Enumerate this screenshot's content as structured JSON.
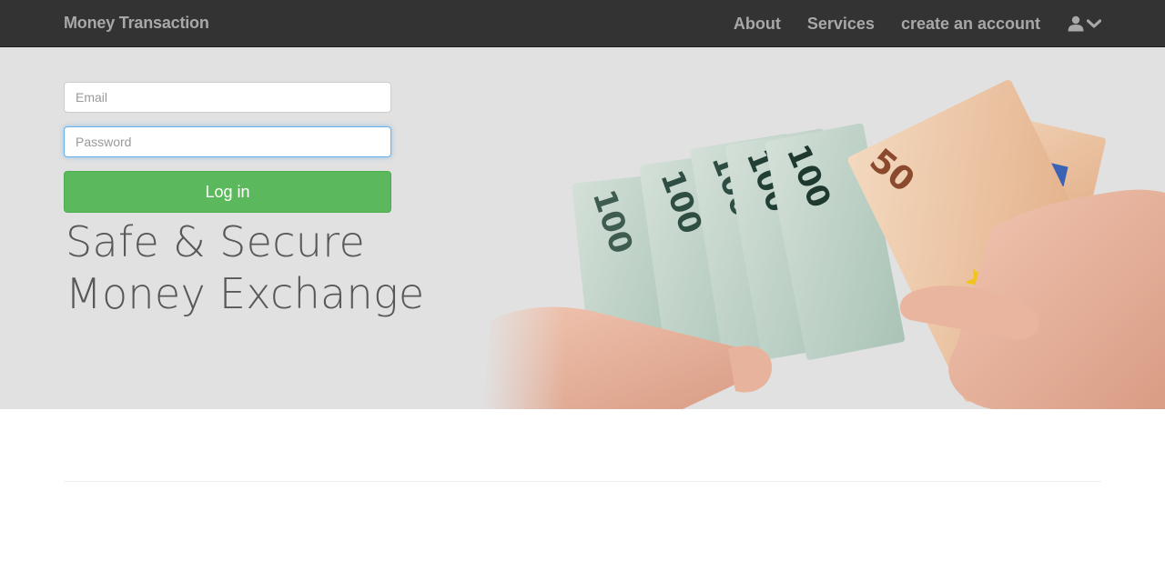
{
  "navbar": {
    "brand": "Money Transaction",
    "links": [
      "About",
      "Services",
      "create an account"
    ],
    "user_menu_icon": "user-icon",
    "dropdown_icon": "chevron-down-icon"
  },
  "login": {
    "email_placeholder": "Email",
    "password_placeholder": "Password",
    "submit_label": "Log in"
  },
  "hero": {
    "tagline_line1": "Safe & Secure",
    "tagline_line2": "Money Exchange",
    "image": "hands-holding-euro-banknotes"
  },
  "colors": {
    "navbar_bg": "#333333",
    "hero_bg": "#e1e1e1",
    "login_button": "#5cb85c",
    "focus_border": "#66afe9"
  }
}
